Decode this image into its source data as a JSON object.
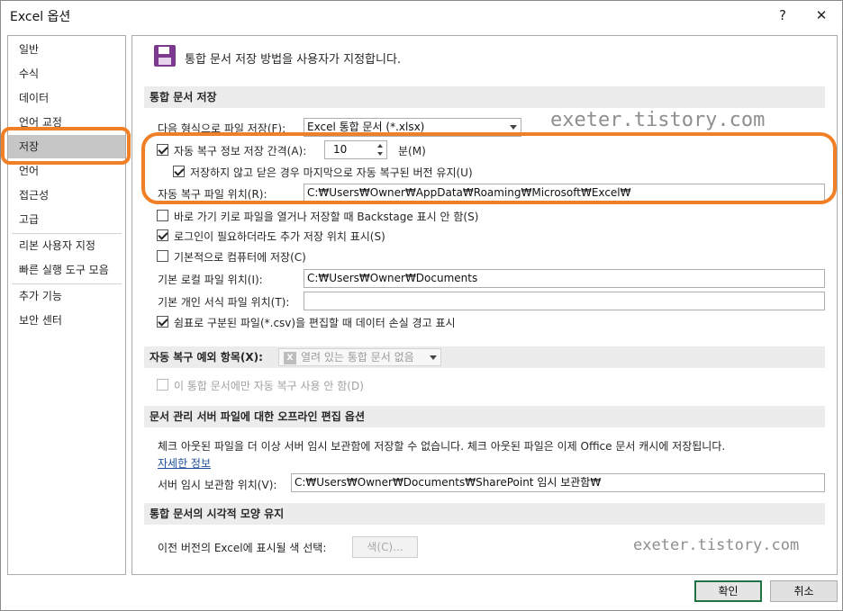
{
  "window": {
    "title": "Excel 옵션",
    "help_glyph": "?",
    "close_glyph": "✕"
  },
  "sidebar": {
    "items": [
      {
        "label": "일반"
      },
      {
        "label": "수식"
      },
      {
        "label": "데이터"
      },
      {
        "label": "언어 교정"
      },
      {
        "label": "저장"
      },
      {
        "label": "언어"
      },
      {
        "label": "접근성"
      },
      {
        "label": "고급"
      },
      {
        "label": "리본 사용자 지정"
      },
      {
        "label": "빠른 실행 도구 모음"
      },
      {
        "label": "추가 기능"
      },
      {
        "label": "보안 센터"
      }
    ],
    "selected_index": 4
  },
  "header": {
    "text": "통합 문서 저장 방법을 사용자가 지정합니다."
  },
  "save_section": {
    "title": "통합 문서 저장",
    "format_label": "다음 형식으로 파일 저장(F):",
    "format_value": "Excel 통합 문서 (*.xlsx)",
    "autorecover_label": "자동 복구 정보 저장 간격(A):",
    "autorecover_checked": true,
    "autorecover_minutes": "10",
    "minutes_label": "분(M)",
    "keep_last_label": "저장하지 않고 닫은 경우 마지막으로 자동 복구된 버전 유지(U)",
    "keep_last_checked": true,
    "autorecover_location_label": "자동 복구 파일 위치(R):",
    "autorecover_location_value": "C:₩Users₩Owner₩AppData₩Roaming₩Microsoft₩Excel₩",
    "backstage_label": "바로 가기 키로 파일을 열거나 저장할 때 Backstage 표시 안 함(S)",
    "backstage_checked": false,
    "signin_label": "로그인이 필요하더라도 추가 저장 위치 표시(S)",
    "signin_checked": true,
    "default_computer_label": "기본적으로 컴퓨터에 저장(C)",
    "default_computer_checked": false,
    "local_location_label": "기본 로컬 파일 위치(I):",
    "local_location_value": "C:₩Users₩Owner₩Documents",
    "template_location_label": "기본 개인 서식 파일 위치(T):",
    "template_location_value": "",
    "csv_warning_label": "쉼표로 구분된 파일(*.csv)을 편집할 때 데이터 손실 경고 표시",
    "csv_warning_checked": true
  },
  "exceptions_section": {
    "title": "자동 복구 예외 항목(X):",
    "workbook_value": "열려 있는 통합 문서 없음",
    "disable_label": "이 통합 문서에만 자동 복구 사용 안 함(D)",
    "disable_checked": false
  },
  "offline_section": {
    "title": "문서 관리 서버 파일에 대한 오프라인 편집 옵션",
    "description": "체크 아웃된 파일을 더 이상 서버 임시 보관함에 저장할 수 없습니다. 체크 아웃된 파일은 이제 Office 문서 캐시에 저장됩니다.",
    "learn_more": "자세한 정보",
    "drafts_label": "서버 임시 보관함 위치(V):",
    "drafts_value": "C:₩Users₩Owner₩Documents₩SharePoint 임시 보관함₩"
  },
  "visual_section": {
    "title": "통합 문서의 시각적 모양 유지",
    "colors_label": "이전 버전의 Excel에 표시될 색 선택:",
    "colors_button": "색(C)..."
  },
  "footer": {
    "ok": "확인",
    "cancel": "취소"
  },
  "watermark": {
    "text1": "exeter.tistory.com",
    "text2": "exeter.tistory.com"
  },
  "colors": {
    "highlight": "#f07f26",
    "ok_border": "#217346",
    "selected_bg": "#c6c6c6",
    "save_icon": "#7b3a8e"
  }
}
